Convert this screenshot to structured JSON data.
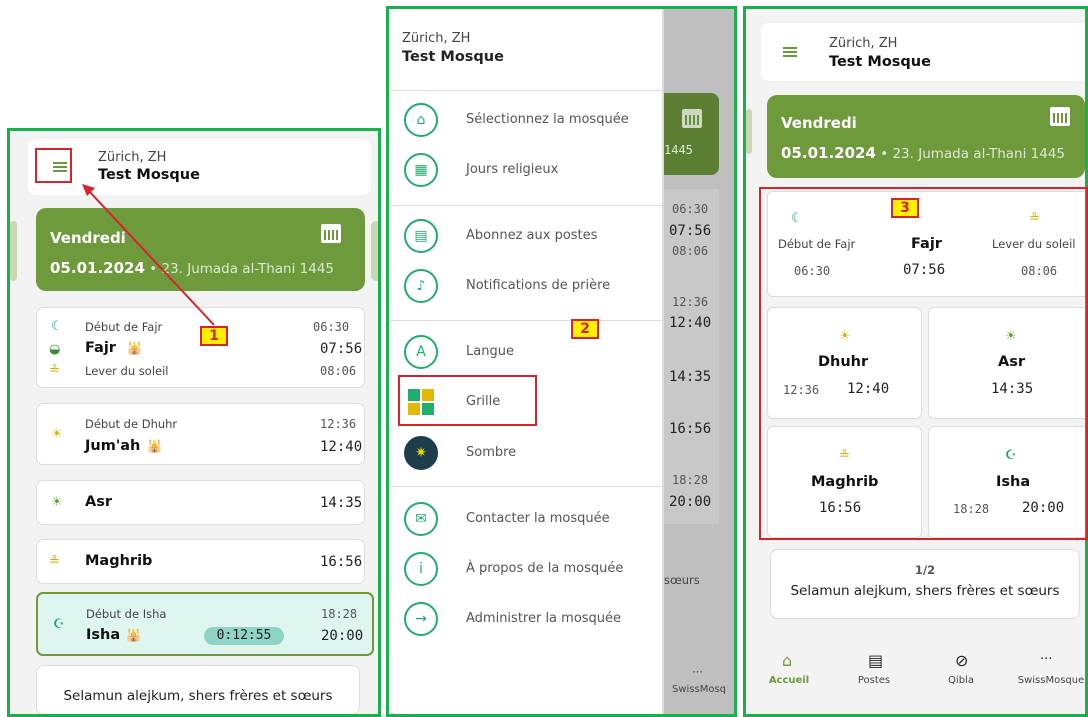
{
  "header": {
    "city": "Zürich, ZH",
    "mosque": "Test Mosque"
  },
  "date": {
    "day": "Vendredi",
    "gregorian": "05.01.2024",
    "separator": " • ",
    "hijri": "23. Jumada al-Thani 1445"
  },
  "left": {
    "fajr": {
      "start_label": "Début de Fajr",
      "start_time": "06:30",
      "name": "Fajr",
      "time": "07:56",
      "sunrise_label": "Lever du soleil",
      "sunrise_time": "08:06"
    },
    "dhuhr": {
      "start_label": "Début de Dhuhr",
      "start_time": "12:36",
      "name": "Jum'ah",
      "time": "12:40"
    },
    "asr": {
      "name": "Asr",
      "time": "14:35"
    },
    "maghrib": {
      "name": "Maghrib",
      "time": "16:56"
    },
    "isha": {
      "start_label": "Début de Isha",
      "start_time": "18:28",
      "name": "Isha",
      "countdown": "0:12:55",
      "time": "20:00"
    },
    "message": "Selamun alejkum, shers frères et sœurs"
  },
  "menu": {
    "items": [
      {
        "label": "Sélectionnez la mosquée",
        "icon": "mosque-icon"
      },
      {
        "label": "Jours religieux",
        "icon": "calendar-icon"
      },
      {
        "label": "Abonnez aux postes",
        "icon": "news-icon"
      },
      {
        "label": "Notifications de prière",
        "icon": "bell-icon"
      },
      {
        "label": "Langue",
        "icon": "language-icon"
      },
      {
        "label": "Grille",
        "icon": "grid-icon"
      },
      {
        "label": "Sombre",
        "icon": "bulb-icon"
      },
      {
        "label": "Contacter la mosquée",
        "icon": "mail-icon"
      },
      {
        "label": "À propos de la mosquée",
        "icon": "info-icon"
      },
      {
        "label": "Administrer la mosquée",
        "icon": "login-icon"
      }
    ],
    "bg_times": [
      "06:30",
      "07:56",
      "08:06",
      "12:36",
      "12:40",
      "14:35",
      "16:56",
      "18:28",
      "20:00"
    ],
    "bg_hijri": "1445",
    "bg_msg": "sœurs",
    "bg_nav": "SwissMosq"
  },
  "grid": {
    "fajr_start_label": "Début de Fajr",
    "fajr_start": "06:30",
    "fajr": "Fajr",
    "fajr_time": "07:56",
    "sunrise_label": "Lever du soleil",
    "sunrise": "08:06",
    "dhuhr": "Dhuhr",
    "dhuhr_start": "12:36",
    "dhuhr_time": "12:40",
    "asr": "Asr",
    "asr_time": "14:35",
    "maghrib": "Maghrib",
    "maghrib_time": "16:56",
    "isha": "Isha",
    "isha_start": "18:28",
    "isha_time": "20:00",
    "page": "1/2",
    "message": "Selamun alejkum, shers frères et sœurs"
  },
  "nav": {
    "home": "Accueil",
    "posts": "Postes",
    "qibla": "Qibla",
    "more": "SwissMosque"
  },
  "annotations": [
    "1",
    "2",
    "3"
  ],
  "colors": {
    "accent": "#6e9a3c",
    "frame": "#17b04a",
    "mark": "#d9232b",
    "teal": "#1fae6b"
  }
}
